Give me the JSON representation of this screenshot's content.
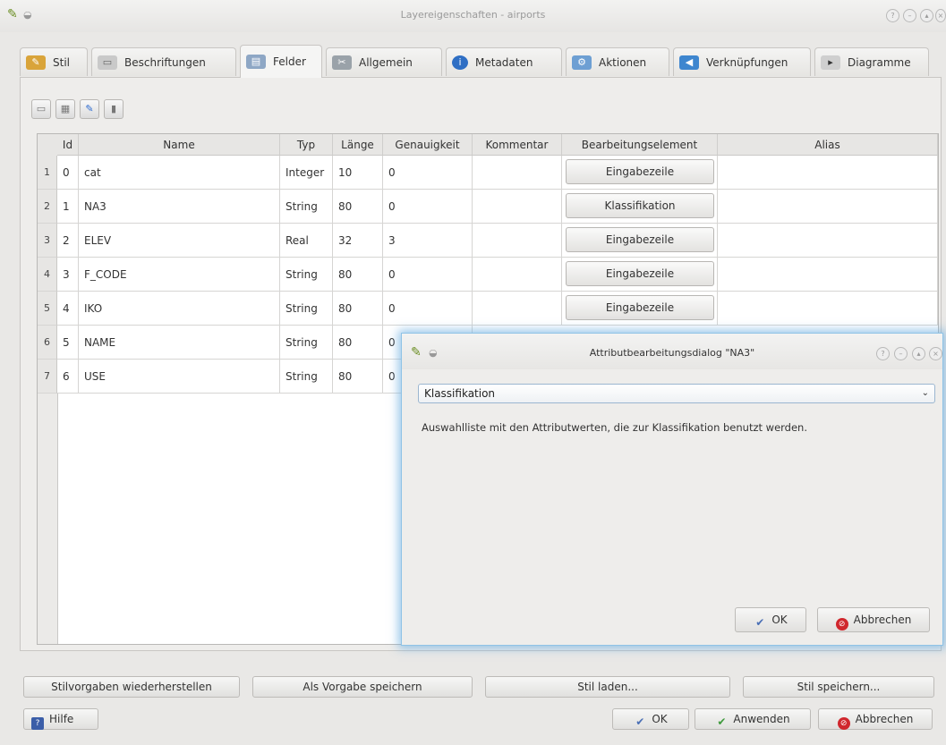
{
  "window": {
    "title": "Layereigenschaften - airports"
  },
  "tabs": [
    {
      "label": "Stil",
      "icon": "paint-brush-icon"
    },
    {
      "label": "Beschriftungen",
      "icon": "label-icon"
    },
    {
      "label": "Felder",
      "icon": "table-icon"
    },
    {
      "label": "Allgemein",
      "icon": "tools-icon"
    },
    {
      "label": "Metadaten",
      "icon": "info-icon"
    },
    {
      "label": "Aktionen",
      "icon": "actions-icon"
    },
    {
      "label": "Verknüpfungen",
      "icon": "join-icon"
    },
    {
      "label": "Diagramme",
      "icon": "diagram-icon"
    }
  ],
  "table": {
    "headers": [
      "Id",
      "Name",
      "Typ",
      "Länge",
      "Genauigkeit",
      "Kommentar",
      "Bearbeitungselement",
      "Alias"
    ],
    "rows": [
      {
        "row": "1",
        "id": "0",
        "name": "cat",
        "typ": "Integer",
        "laenge": "10",
        "genauigkeit": "0",
        "kommentar": "",
        "edit": "Eingabezeile",
        "alias": ""
      },
      {
        "row": "2",
        "id": "1",
        "name": "NA3",
        "typ": "String",
        "laenge": "80",
        "genauigkeit": "0",
        "kommentar": "",
        "edit": "Klassifikation",
        "alias": ""
      },
      {
        "row": "3",
        "id": "2",
        "name": "ELEV",
        "typ": "Real",
        "laenge": "32",
        "genauigkeit": "3",
        "kommentar": "",
        "edit": "Eingabezeile",
        "alias": ""
      },
      {
        "row": "4",
        "id": "3",
        "name": "F_CODE",
        "typ": "String",
        "laenge": "80",
        "genauigkeit": "0",
        "kommentar": "",
        "edit": "Eingabezeile",
        "alias": ""
      },
      {
        "row": "5",
        "id": "4",
        "name": "IKO",
        "typ": "String",
        "laenge": "80",
        "genauigkeit": "0",
        "kommentar": "",
        "edit": "Eingabezeile",
        "alias": ""
      },
      {
        "row": "6",
        "id": "5",
        "name": "NAME",
        "typ": "String",
        "laenge": "80",
        "genauigkeit": "0",
        "kommentar": "",
        "edit": "",
        "alias": ""
      },
      {
        "row": "7",
        "id": "6",
        "name": "USE",
        "typ": "String",
        "laenge": "80",
        "genauigkeit": "0",
        "kommentar": "",
        "edit": "",
        "alias": ""
      }
    ]
  },
  "dialog": {
    "title": "Attributbearbeitungsdialog \"NA3\"",
    "selected": "Klassifikation",
    "description": "Auswahlliste mit den Attributwerten, die zur Klassifikation benutzt werden.",
    "ok": "OK",
    "cancel": "Abbrechen"
  },
  "style_buttons": {
    "restore": "Stilvorgaben wiederherstellen",
    "save_default": "Als Vorgabe speichern",
    "load": "Stil laden...",
    "save": "Stil speichern..."
  },
  "footer": {
    "help": "Hilfe",
    "ok": "OK",
    "apply": "Anwenden",
    "cancel": "Abbrechen"
  },
  "colors": {
    "accent": "#8fc3e6",
    "cancel_red": "#d0272d",
    "ok_blue": "#4a6fb5",
    "apply_green": "#3e9a3c"
  }
}
